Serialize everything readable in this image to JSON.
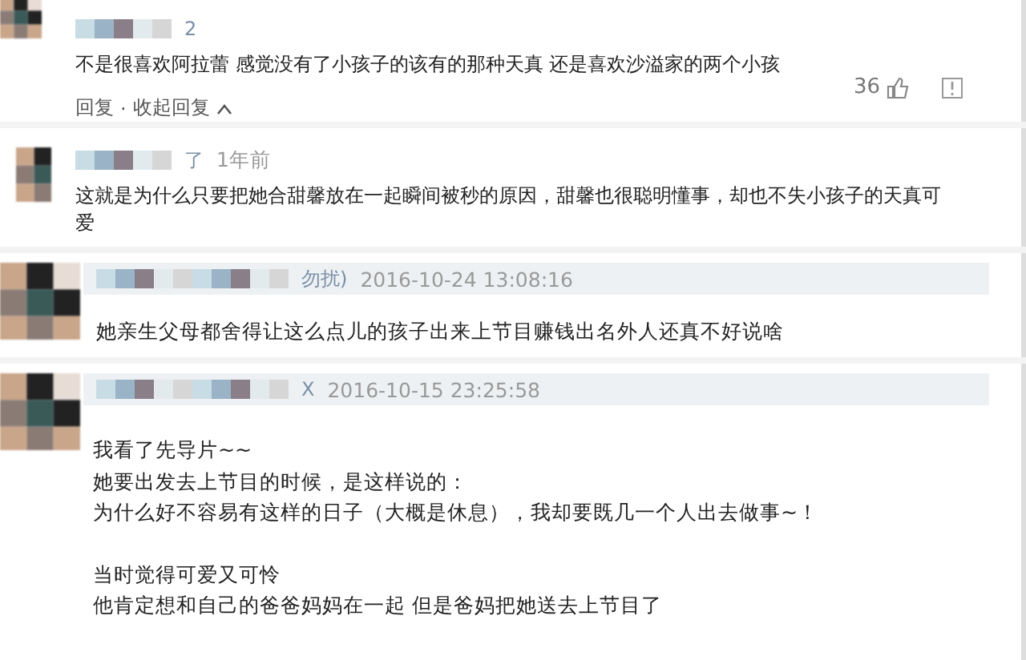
{
  "comments": [
    {
      "kind": "full",
      "meta": [
        {
          "kind": "name",
          "text": "2"
        }
      ],
      "body": [
        [
          "不是很喜欢阿拉蕾 感觉没有了小孩子的该有的那种天真 还是喜欢沙溢家的两个小孩"
        ]
      ],
      "actions": [
        "回复",
        "·",
        "收起回复"
      ],
      "likes": "36"
    },
    {
      "kind": "plain",
      "meta": [
        {
          "kind": "name",
          "text": "了"
        },
        {
          "kind": "time",
          "text": "1年前"
        }
      ],
      "body": [
        [
          "这就是为什么只要把她合甜馨放在一起瞬间被秒的原因，甜馨也很聪明懂事，却也不失小孩子的天真可爱"
        ]
      ]
    },
    {
      "kind": "bar",
      "meta": [
        {
          "kind": "name",
          "text": "勿扰)"
        },
        {
          "kind": "time",
          "text": "2016-10-24 13:08:16"
        }
      ],
      "body": [
        [
          "她亲生父母都舍得让这么点儿的孩子出来上节目赚钱出名外人还真不好说啥"
        ]
      ]
    },
    {
      "kind": "bar",
      "meta": [
        {
          "kind": "name",
          "text": "X"
        },
        {
          "kind": "time",
          "text": "2016-10-15 23:25:58"
        }
      ],
      "body": [
        [
          "我看了先导片~~",
          "她要出发去上节目的时候，是这样说的：",
          "为什么好不容易有这样的日子（大概是休息），我却要既几一个人出去做事~！"
        ],
        [
          "当时觉得可爱又可怜",
          "他肯定想和自己的爸爸妈妈在一起 但是爸妈把她送去上节目了"
        ]
      ]
    }
  ]
}
